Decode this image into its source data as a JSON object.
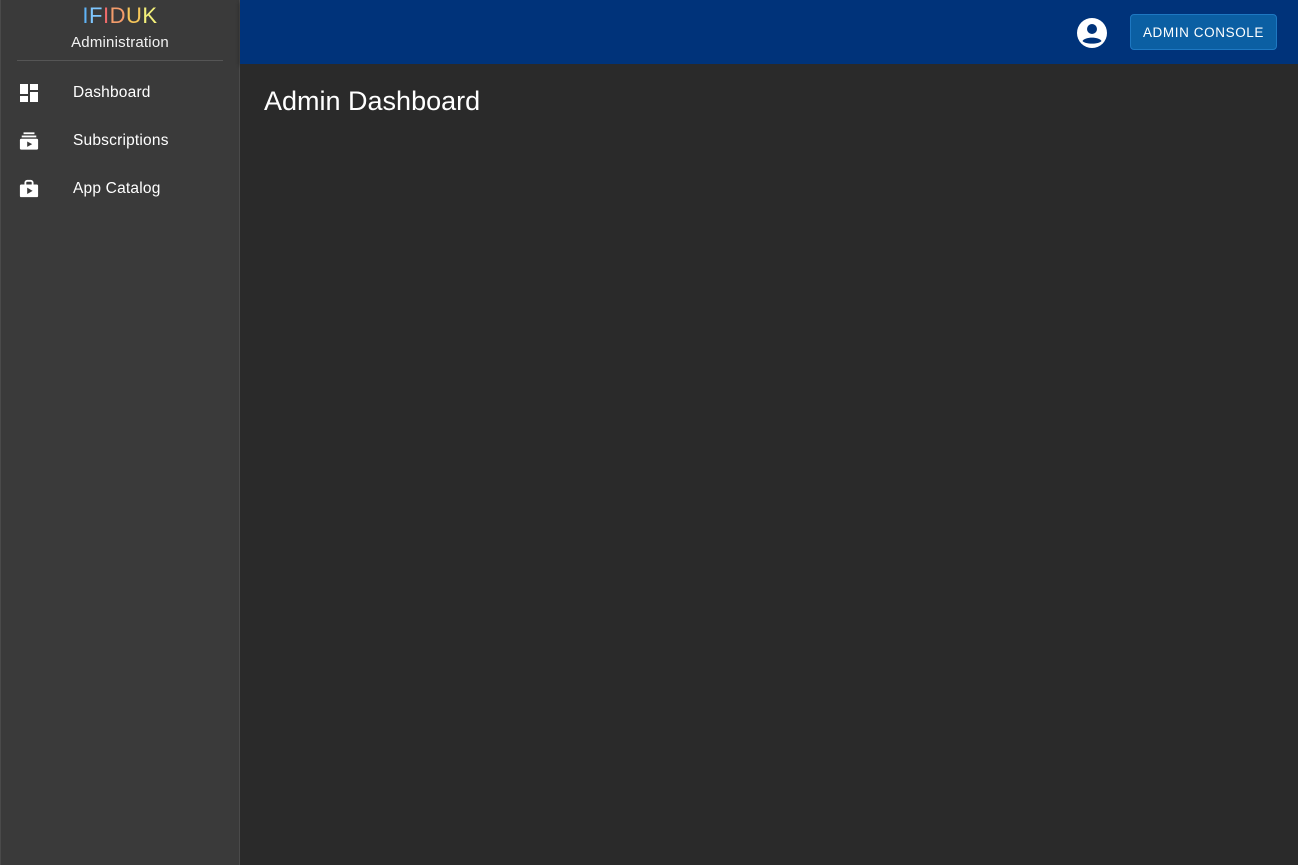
{
  "brand": {
    "logo_letters": [
      {
        "char": "I",
        "color": "#5fb3f6"
      },
      {
        "char": "F",
        "color": "#7fc7ff"
      },
      {
        "char": "I",
        "color": "#f06b6b"
      },
      {
        "char": "D",
        "color": "#f39c6b"
      },
      {
        "char": "U",
        "color": "#f6c65a"
      },
      {
        "char": "K",
        "color": "#f3f07a"
      }
    ],
    "subtitle": "Administration"
  },
  "sidebar": {
    "items": [
      {
        "label": "Dashboard",
        "icon": "dashboard-icon"
      },
      {
        "label": "Subscriptions",
        "icon": "subscriptions-icon"
      },
      {
        "label": "App Catalog",
        "icon": "shop-icon"
      }
    ]
  },
  "topbar": {
    "account_icon": "account-circle-icon",
    "admin_console_label": "ADMIN CONSOLE",
    "background": "#00337a",
    "button_color": "#0b5fa3"
  },
  "main": {
    "title": "Admin Dashboard"
  }
}
